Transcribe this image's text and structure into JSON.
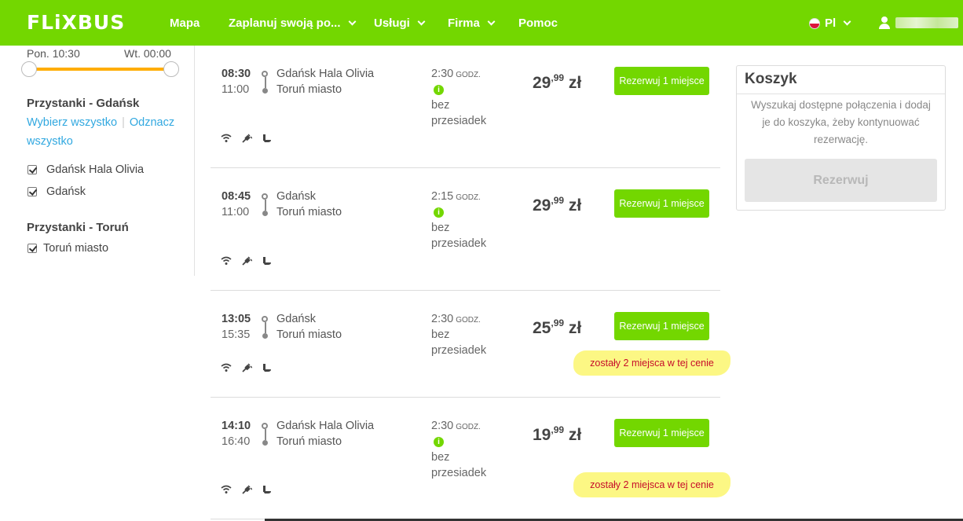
{
  "header": {
    "logo": "FLiXBUS",
    "nav": [
      "Mapa",
      "Zaplanuj swoją po...",
      "Usługi",
      "Firma",
      "Pomoc"
    ],
    "language": "Pl"
  },
  "sidebar": {
    "time_from": "Pon. 10:30",
    "time_to": "Wt. 00:00",
    "section_gdansk": "Przystanki - Gdańsk",
    "select_all": "Wybierz wszystko",
    "deselect_all": "Odznacz wszystko",
    "gdansk_stops": [
      "Gdańsk Hala Olivia",
      "Gdańsk"
    ],
    "section_torun": "Przystanki - Toruń",
    "torun_stops": [
      "Toruń miasto"
    ]
  },
  "results": [
    {
      "dep": "08:30",
      "arr": "11:00",
      "from": "Gdańsk Hala Olivia",
      "to": "Toruń miasto",
      "duration": "2:30",
      "unit": "GODZ.",
      "transfer": "bez przesiadek",
      "info": true,
      "price_main": "29",
      "price_dec": "99",
      "currency": "zł",
      "button": "Rezerwuj 1 miejsce",
      "warning": ""
    },
    {
      "dep": "08:45",
      "arr": "11:00",
      "from": "Gdańsk",
      "to": "Toruń miasto",
      "duration": "2:15",
      "unit": "GODZ.",
      "transfer": "bez przesiadek",
      "info": true,
      "price_main": "29",
      "price_dec": "99",
      "currency": "zł",
      "button": "Rezerwuj 1 miejsce",
      "warning": ""
    },
    {
      "dep": "13:05",
      "arr": "15:35",
      "from": "Gdańsk",
      "to": "Toruń miasto",
      "duration": "2:30",
      "unit": "GODZ.",
      "transfer": "bez przesiadek",
      "info": false,
      "price_main": "25",
      "price_dec": "99",
      "currency": "zł",
      "button": "Rezerwuj 1 miejsce",
      "warning": "zostały 2 miejsca w tej cenie"
    },
    {
      "dep": "14:10",
      "arr": "16:40",
      "from": "Gdańsk Hala Olivia",
      "to": "Toruń miasto",
      "duration": "2:30",
      "unit": "GODZ.",
      "transfer": "bez przesiadek",
      "info": true,
      "price_main": "19",
      "price_dec": "99",
      "currency": "zł",
      "button": "Rezerwuj 1 miejsce",
      "warning": "zostały 2 miejsca w tej cenie"
    }
  ],
  "cart": {
    "title": "Koszyk",
    "text": "Wyszukaj dostępne połączenia i dodaj je do koszyka, żeby kontynuować rezerwację.",
    "button": "Rezerwuj"
  },
  "colors": {
    "brand": "#73d700",
    "accent": "#ffad00",
    "link": "#31a8e0",
    "warning": "#c4001f"
  }
}
